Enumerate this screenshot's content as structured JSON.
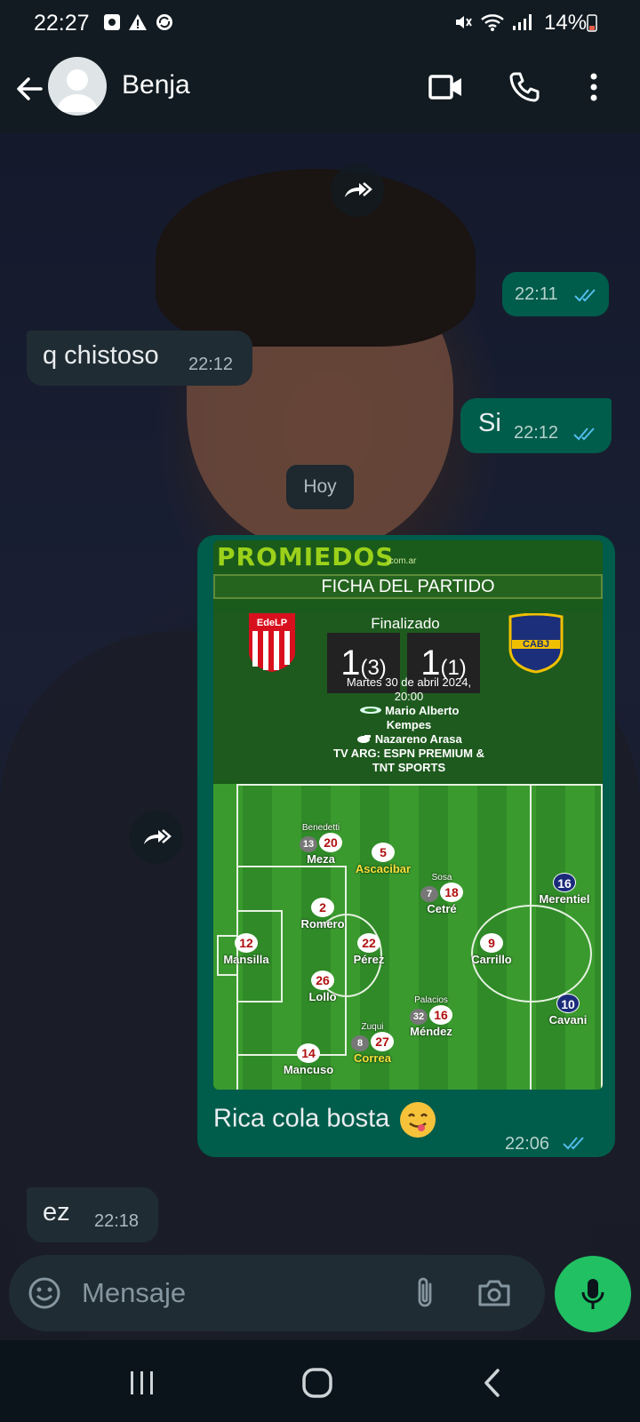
{
  "status_bar": {
    "time": "22:27",
    "battery": "14%"
  },
  "header": {
    "contact_name": "Benja"
  },
  "messages": {
    "m1": {
      "time": "22:11"
    },
    "m2": {
      "text": "q chistoso",
      "time": "22:12"
    },
    "m3": {
      "text": "Si",
      "time": "22:12"
    },
    "date_chip": "Hoy",
    "m4": {
      "caption": "Rica cola bosta",
      "time": "22:06"
    },
    "m5": {
      "text": "ez",
      "time": "22:18"
    }
  },
  "match_card": {
    "logo": "PROMIEDOS",
    "logo_domain": ".com.ar",
    "title": "FICHA DEL PARTIDO",
    "home_shield": "EdeLP",
    "away_shield": "CABJ",
    "status": "Finalizado",
    "home_score": "1",
    "home_pens": "(3)",
    "away_score": "1",
    "away_pens": "(1)",
    "date_line1": "Martes 30 de abril 2024,",
    "date_line2": "20:00",
    "stadium_line1": "Mario Alberto",
    "stadium_line2": "Kempes",
    "referee": "Nazareno Arasa",
    "tv_line1": "TV ARG: ESPN PREMIUM &",
    "tv_line2": "TNT SPORTS",
    "players": [
      {
        "num": "20",
        "name": "Meza",
        "sub_num": "13",
        "sub_name": "Benedetti"
      },
      {
        "num": "5",
        "name": "Ascacibar"
      },
      {
        "num": "18",
        "name": "Cetré",
        "sub_num": "7",
        "sub_name": "Sosa"
      },
      {
        "num": "2",
        "name": "Romero"
      },
      {
        "num": "12",
        "name": "Mansilla"
      },
      {
        "num": "22",
        "name": "Pérez"
      },
      {
        "num": "26",
        "name": "Lollo"
      },
      {
        "num": "16",
        "name": "Méndez",
        "sub_num": "32",
        "sub_name": "Palacios"
      },
      {
        "num": "27",
        "name": "Correa",
        "sub_num": "8",
        "sub_name": "Zuqui"
      },
      {
        "num": "14",
        "name": "Mancuso"
      },
      {
        "num": "9",
        "name": "Carrillo"
      },
      {
        "num": "16",
        "name": "Merentiel"
      },
      {
        "num": "10",
        "name": "Cavani"
      }
    ]
  },
  "composer": {
    "placeholder": "Mensaje"
  },
  "icons": {
    "back": "arrow-left-icon",
    "video": "video-camera-icon",
    "call": "phone-icon",
    "menu": "more-vertical-icon",
    "forward": "forward-icon",
    "emoji": "emoji-icon",
    "attach": "paperclip-icon",
    "camera": "camera-icon",
    "mic": "microphone-icon"
  },
  "colors": {
    "header_bg": "#111b21",
    "incoming_bubble": "#202c33",
    "outgoing_bubble": "#005c4b",
    "read_ticks": "#53bdeb",
    "mic_button": "#21c063"
  }
}
